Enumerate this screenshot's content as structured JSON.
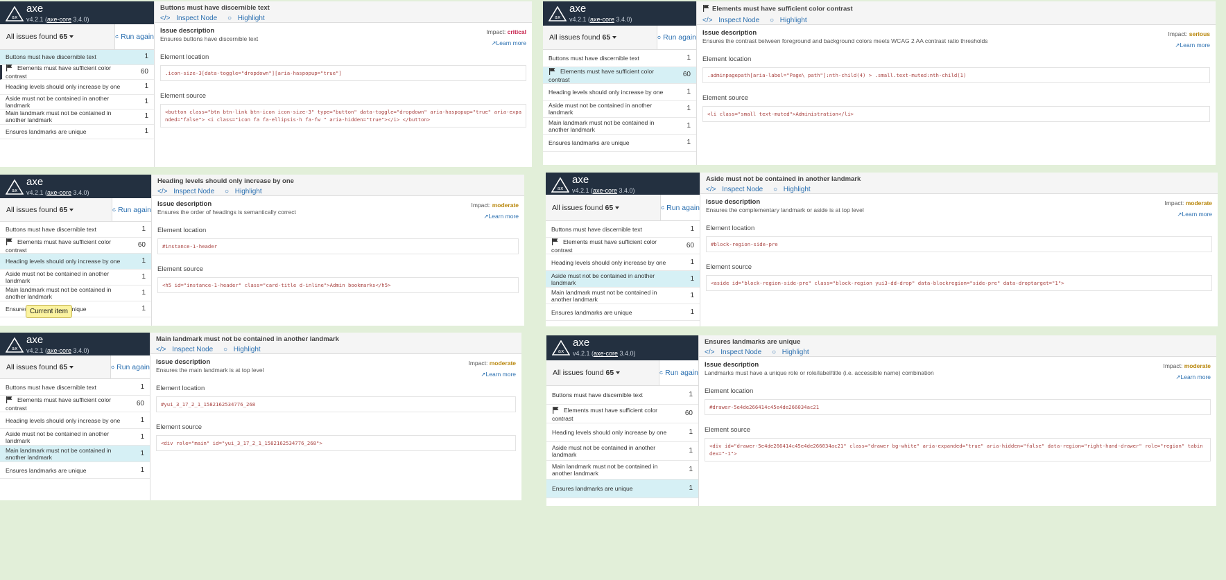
{
  "brand": {
    "name": "axe",
    "version_prefix": "v4.2.1 (",
    "core_link": "axe-core",
    "version_suffix": " 3.4.0)"
  },
  "filter": {
    "label": "All issues",
    "found_prefix": "found",
    "count": "65"
  },
  "actions": {
    "run_again": "Run again",
    "inspect_node": "Inspect Node",
    "highlight": "Highlight",
    "learn_more": "Learn more"
  },
  "labels": {
    "issue_description": "Issue description",
    "impact": "Impact:",
    "element_location": "Element location",
    "element_source": "Element source"
  },
  "issues": [
    {
      "title": "Buttons must have discernible text",
      "count": "1"
    },
    {
      "title": "Elements must have sufficient color contrast",
      "count": "60"
    },
    {
      "title": "Heading levels should only increase by one",
      "count": "1"
    },
    {
      "title": "Aside must not be contained in another landmark",
      "count": "1"
    },
    {
      "title": "Main landmark must not be contained in another landmark",
      "count": "1"
    },
    {
      "title": "Ensures landmarks are unique",
      "count": "1"
    }
  ],
  "panels": [
    {
      "title": "Buttons must have discernible text",
      "description": "Ensures buttons have discernible text",
      "impact": "critical",
      "impact_color": "#c7254e",
      "location": ".icon-size-3[data-toggle=\"dropdown\"][aria-haspopup=\"true\"]",
      "source": "<button class=\"btn btn-link btn-icon icon-size-3\" type=\"button\" data-toggle=\"dropdown\" aria-haspopup=\"true\" aria-expanded=\"false\"> <i class=\"icon fa fa-ellipsis-h fa-fw \" aria-hidden=\"true\"></i> </button>"
    },
    {
      "title": "Elements must have sufficient color contrast",
      "description": "Ensures the contrast between foreground and background colors meets WCAG 2 AA contrast ratio thresholds",
      "impact": "serious",
      "impact_color": "#b8860b",
      "location": ".adminpagepath[aria-label=\"Page\\ path\"]:nth-child(4) > .small.text-muted:nth-child(1)",
      "source": "<li class=\"small text-muted\">Administration</li>"
    },
    {
      "title": "Heading levels should only increase by one",
      "description": "Ensures the order of headings is semantically correct",
      "impact": "moderate",
      "impact_color": "#b8860b",
      "location": "#instance-1-header",
      "source": "<h5 id=\"instance-1-header\" class=\"card-title d-inline\">Admin bookmarks</h5>"
    },
    {
      "title": "Aside must not be contained in another landmark",
      "description": "Ensures the complementary landmark or aside is at top level",
      "impact": "moderate",
      "impact_color": "#b8860b",
      "location": "#block-region-side-pre",
      "source": "<aside id=\"block-region-side-pre\" class=\"block-region yui3-dd-drop\" data-blockregion=\"side-pre\" data-droptarget=\"1\">"
    },
    {
      "title": "Main landmark must not be contained in another landmark",
      "description": "Ensures the main landmark is at top level",
      "impact": "moderate",
      "impact_color": "#b8860b",
      "location": "#yui_3_17_2_1_1582162534776_268",
      "source": "<div role=\"main\" id=\"yui_3_17_2_1_1582162534776_268\">"
    },
    {
      "title": "Ensures landmarks are unique",
      "description": "Landmarks must have a unique role or role/label/title (i.e. accessible name) combination",
      "impact": "moderate",
      "impact_color": "#b8860b",
      "location": "#drawer-5e4de266414c45e4de266034ac21",
      "source": "<div id=\"drawer-5e4de266414c45e4de266034ac21\" class=\"drawer bg-white\" aria-expanded=\"true\" aria-hidden=\"false\" data-region=\"right-hand-drawer\" role=\"region\" tabindex=\"-1\">"
    }
  ],
  "tooltip": "Current item"
}
